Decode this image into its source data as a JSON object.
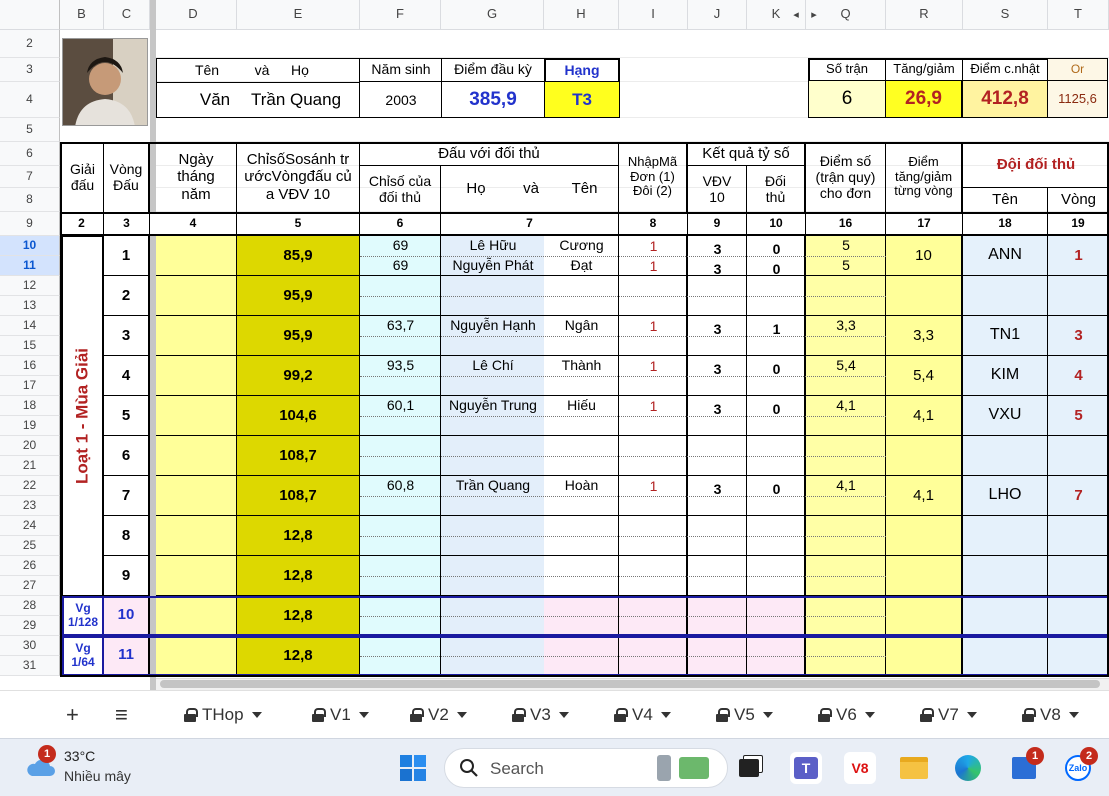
{
  "column_headers": {
    "A": "",
    "B": "B",
    "C": "C",
    "D": "D",
    "E": "E",
    "F": "F",
    "G": "G",
    "H": "H",
    "I": "I",
    "J": "J",
    "K": "K",
    "Q": "Q",
    "R": "R",
    "S": "S",
    "T": "T"
  },
  "row_numbers": [
    "2",
    "3",
    "4",
    "5",
    "6",
    "7",
    "8",
    "9",
    "10",
    "11",
    "12",
    "13",
    "14",
    "15",
    "16",
    "17",
    "18",
    "19",
    "20",
    "21",
    "22",
    "23",
    "24",
    "25",
    "26",
    "27",
    "28",
    "29",
    "30",
    "31"
  ],
  "player": {
    "name_label_1": "Tên",
    "name_label_2": "và",
    "name_label_3": "Họ",
    "first_name": "Văn",
    "family_name": "Trần Quang",
    "birth_year_label": "Năm sinh",
    "birth_year": "2003",
    "start_score_label": "Điểm đầu kỳ",
    "start_score": "385,9",
    "rank_label": "Hạng",
    "rank": "T3",
    "matches_label": "Số trận",
    "matches": "6",
    "change_label": "Tăng/giảm",
    "change": "26,9",
    "updated_label": "Điểm c.nhật",
    "updated": "412,8",
    "orig_label": "Or",
    "orig": "1125,6"
  },
  "table_headers": {
    "tournament": "Giải đấu",
    "round": "Vòng Đấu",
    "date": "Ngày tháng năm",
    "index_before": "ChỉsốSosánh trướcVòngđấu của VĐV 10",
    "vs_opponent": "Đấu với đối thủ",
    "opp_index": "Chỉsố của đối thủ",
    "opp_family": "Họ",
    "opp_and": "và",
    "opp_name": "Tên",
    "entry_code": "NhậpMã Đơn (1) Đôi (2)",
    "score_result": "Kết quả tỷ số",
    "vdv": "VĐV 10",
    "opponent": "Đối thủ",
    "points": "Điểm số (trận quy) cho đơn",
    "round_change": "Điểm tăng/giảm từng vòng",
    "opp_team": "Đội đối thủ",
    "team_name": "Tên",
    "team_round": "Vòng"
  },
  "column_numbers": [
    "2",
    "3",
    "4",
    "5",
    "6",
    "7",
    "8",
    "9",
    "10",
    "16",
    "17",
    "18",
    "19"
  ],
  "season_label": "Loạt 1 - Mùa Giải",
  "rounds": [
    {
      "round": "1",
      "index": "85,9",
      "matches": [
        {
          "opp_index": "69",
          "family": "Lê Hữu",
          "name": "Cương",
          "code": "1",
          "vdv": "3",
          "opp": "0",
          "pts": "5"
        },
        {
          "opp_index": "69",
          "family": "Nguyễn Phát",
          "name": "Đạt",
          "code": "1",
          "vdv": "3",
          "opp": "0",
          "pts": "5"
        }
      ],
      "change": "10",
      "team": "ANN",
      "team_round": "1"
    },
    {
      "round": "2",
      "index": "95,9",
      "matches": [],
      "change": "",
      "team": "",
      "team_round": ""
    },
    {
      "round": "3",
      "index": "95,9",
      "matches": [
        {
          "opp_index": "63,7",
          "family": "Nguyễn Hạnh",
          "name": "Ngân",
          "code": "1",
          "vdv": "3",
          "opp": "1",
          "pts": "3,3"
        }
      ],
      "change": "3,3",
      "team": "TN1",
      "team_round": "3"
    },
    {
      "round": "4",
      "index": "99,2",
      "matches": [
        {
          "opp_index": "93,5",
          "family": "Lê Chí",
          "name": "Thành",
          "code": "1",
          "vdv": "3",
          "opp": "0",
          "pts": "5,4"
        }
      ],
      "change": "5,4",
      "team": "KIM",
      "team_round": "4"
    },
    {
      "round": "5",
      "index": "104,6",
      "matches": [
        {
          "opp_index": "60,1",
          "family": "Nguyễn Trung",
          "name": "Hiếu",
          "code": "1",
          "vdv": "3",
          "opp": "0",
          "pts": "4,1"
        }
      ],
      "change": "4,1",
      "team": "VXU",
      "team_round": "5"
    },
    {
      "round": "6",
      "index": "108,7",
      "matches": [],
      "change": "",
      "team": "",
      "team_round": ""
    },
    {
      "round": "7",
      "index": "108,7",
      "matches": [
        {
          "opp_index": "60,8",
          "family": "Trần Quang",
          "name": "Hoàn",
          "code": "1",
          "vdv": "3",
          "opp": "0",
          "pts": "4,1"
        }
      ],
      "change": "4,1",
      "team": "LHO",
      "team_round": "7"
    },
    {
      "round": "8",
      "index": "12,8",
      "matches": [],
      "change": "",
      "team": "",
      "team_round": ""
    },
    {
      "round": "9",
      "index": "12,8",
      "matches": [],
      "change": "",
      "team": "",
      "team_round": ""
    },
    {
      "round": "10",
      "index": "12,8",
      "matches": [],
      "change": "",
      "team": "",
      "team_round": "",
      "stage": "Vg 1/128"
    },
    {
      "round": "11",
      "index": "12,8",
      "matches": [],
      "change": "",
      "team": "",
      "team_round": "",
      "stage": "Vg 1/64"
    }
  ],
  "sheet_tabs": {
    "add": "+",
    "menu": "≡",
    "tabs": [
      "THop",
      "V1",
      "V2",
      "V3",
      "V4",
      "V5",
      "V6",
      "V7",
      "V8"
    ]
  },
  "taskbar": {
    "weather_badge": "1",
    "temperature": "33°C",
    "weather_text": "Nhiều mây",
    "search_placeholder": "Search",
    "store_badge": "1",
    "zalo_badge": "2",
    "zalo_label": "Zalo",
    "v8_label": "V8",
    "teams_label": "T"
  },
  "colors": {
    "yellow": "#ffff99",
    "olive": "#ddd800",
    "red_text": "#b22222",
    "blue_text": "#2233cc",
    "cyan": "#e0fbfd",
    "pink": "#fde9f6",
    "navy_border": "#1a1aa0"
  }
}
